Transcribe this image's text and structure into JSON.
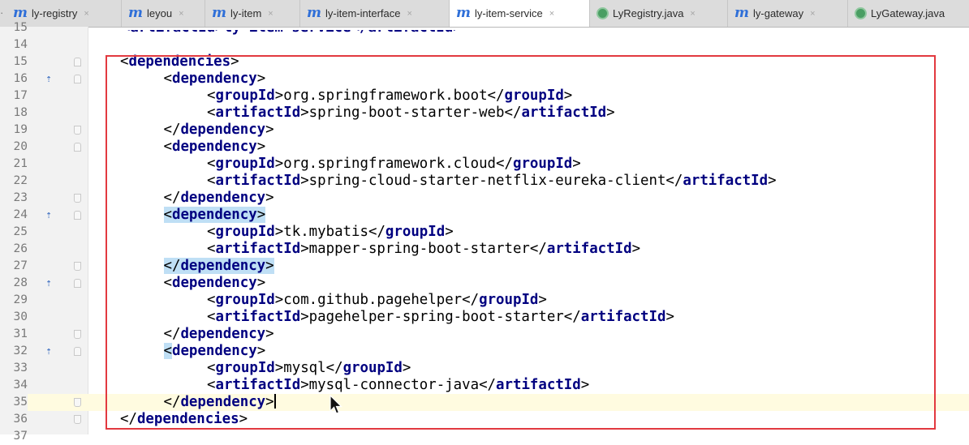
{
  "tabs": [
    {
      "label": "ly-registry",
      "icon": "maven-module-icon",
      "active": false
    },
    {
      "label": "leyou",
      "icon": "maven-module-icon",
      "active": false
    },
    {
      "label": "ly-item",
      "icon": "maven-module-icon",
      "active": false
    },
    {
      "label": "ly-item-interface",
      "icon": "maven-module-icon",
      "active": false
    },
    {
      "label": "ly-item-service",
      "icon": "maven-module-icon",
      "active": true
    },
    {
      "label": "LyRegistry.java",
      "icon": "java-class-icon",
      "active": false
    },
    {
      "label": "ly-gateway",
      "icon": "maven-module-icon",
      "active": false
    },
    {
      "label": "LyGateway.java",
      "icon": "java-class-icon",
      "active": false
    }
  ],
  "editor": {
    "lines": [
      {
        "n": "15",
        "text": "    <artifactId>ly-item-service</artifactId>"
      },
      {
        "n": "14"
      },
      {
        "n": "15",
        "open": "dependencies"
      },
      {
        "n": "16",
        "open": "dependency"
      },
      {
        "n": "17",
        "tag": "groupId",
        "value": "org.springframework.boot"
      },
      {
        "n": "18",
        "tag": "artifactId",
        "value": "spring-boot-starter-web"
      },
      {
        "n": "19",
        "close": "dependency"
      },
      {
        "n": "20",
        "open": "dependency"
      },
      {
        "n": "21",
        "tag": "groupId",
        "value": "org.springframework.cloud"
      },
      {
        "n": "22",
        "tag": "artifactId",
        "value": "spring-cloud-starter-netflix-eureka-client"
      },
      {
        "n": "23",
        "close": "dependency"
      },
      {
        "n": "24",
        "open": "dependency"
      },
      {
        "n": "25",
        "tag": "groupId",
        "value": "tk.mybatis"
      },
      {
        "n": "26",
        "tag": "artifactId",
        "value": "mapper-spring-boot-starter"
      },
      {
        "n": "27",
        "close": "dependency"
      },
      {
        "n": "28",
        "open": "dependency"
      },
      {
        "n": "29",
        "tag": "groupId",
        "value": "com.github.pagehelper"
      },
      {
        "n": "30",
        "tag": "artifactId",
        "value": "pagehelper-spring-boot-starter"
      },
      {
        "n": "31",
        "close": "dependency"
      },
      {
        "n": "32",
        "open": "dependency"
      },
      {
        "n": "33",
        "tag": "groupId",
        "value": "mysql"
      },
      {
        "n": "34",
        "tag": "artifactId",
        "value": "mysql-connector-java"
      },
      {
        "n": "35",
        "close": "dependency"
      },
      {
        "n": "36",
        "close": "dependencies"
      },
      {
        "n": "37"
      }
    ]
  },
  "colors": {
    "tag": "#000080",
    "match_highlight": "#bfdff5",
    "current_line": "#fffbe0",
    "annotation_box": "#e2393f"
  }
}
